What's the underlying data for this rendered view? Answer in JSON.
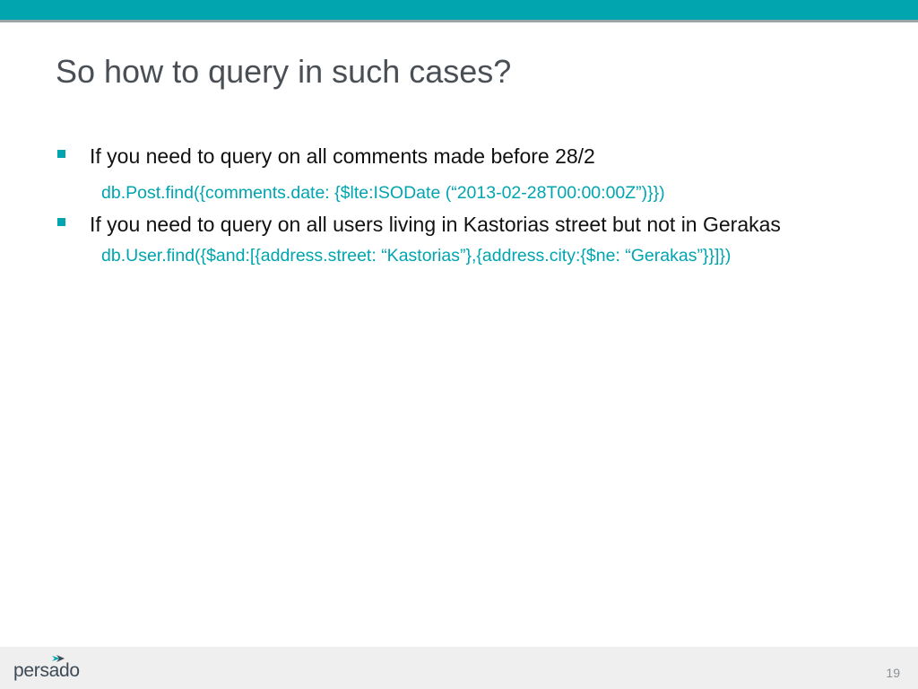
{
  "slide": {
    "title": "So how to query in such cases?",
    "bullets": [
      {
        "text": "If you need to query on all comments made before 28/2",
        "code": "db.Post.find({comments.date: {$lte:ISODate (“2013-02-28T00:00:00Z”)}})"
      },
      {
        "text": "If you need to query on all users living in Kastorias street but not in Gerakas",
        "code": "db.User.find({$and:[{address.street: “Kastorias”},{address.city:{$ne: “Gerakas”}}]})"
      }
    ]
  },
  "footer": {
    "logo_text": "persado",
    "page_number": "19"
  },
  "colors": {
    "accent": "#00a5b0",
    "title": "#4a4f55",
    "body_text": "#111111",
    "footer_bg": "#efefef"
  },
  "icons": {
    "bullet": "square-bullet-icon",
    "logo_mark": "persado-chevron-icon"
  }
}
